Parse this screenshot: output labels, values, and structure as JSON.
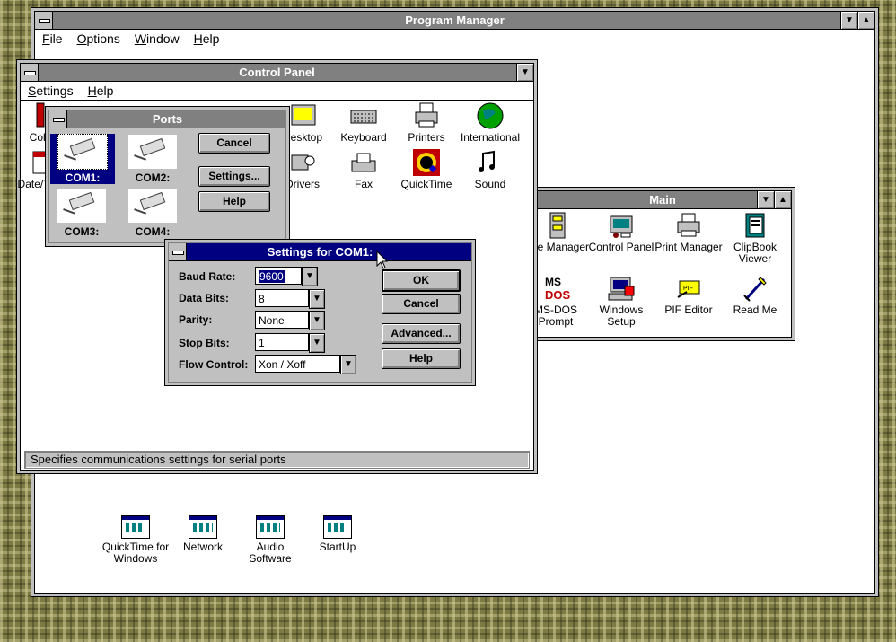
{
  "program_manager": {
    "title": "Program Manager",
    "menu": [
      "File",
      "Options",
      "Window",
      "Help"
    ]
  },
  "control_panel": {
    "title": "Control Panel",
    "menu": [
      "Settings",
      "Help"
    ],
    "icons": [
      {
        "label": "Color",
        "icon": "color-icon"
      },
      {
        "label": "Desktop",
        "icon": "desktop-icon"
      },
      {
        "label": "Keyboard",
        "icon": "keyboard-icon"
      },
      {
        "label": "Printers",
        "icon": "printer-icon"
      },
      {
        "label": "International",
        "icon": "globe-icon"
      },
      {
        "label": "Date/Time",
        "icon": "clock-icon"
      },
      {
        "label": "Drivers",
        "icon": "drivers-icon"
      },
      {
        "label": "Fax",
        "icon": "fax-icon"
      },
      {
        "label": "QuickTime",
        "icon": "quicktime-icon"
      },
      {
        "label": "Sound",
        "icon": "sound-icon"
      }
    ],
    "status": "Specifies communications settings for serial ports"
  },
  "ports": {
    "title": "Ports",
    "items": [
      "COM1:",
      "COM2:",
      "COM3:",
      "COM4:"
    ],
    "buttons": {
      "cancel": "Cancel",
      "settings": "Settings...",
      "help": "Help"
    }
  },
  "settings_dialog": {
    "title": "Settings for COM1:",
    "fields": {
      "baud_label": "Baud Rate:",
      "baud_value": "9600",
      "data_label": "Data Bits:",
      "data_value": "8",
      "parity_label": "Parity:",
      "parity_value": "None",
      "stop_label": "Stop Bits:",
      "stop_value": "1",
      "flow_label": "Flow Control:",
      "flow_value": "Xon / Xoff"
    },
    "buttons": {
      "ok": "OK",
      "cancel": "Cancel",
      "advanced": "Advanced...",
      "help": "Help"
    }
  },
  "main_group": {
    "title": "Main",
    "icons": [
      {
        "label": "File Manager",
        "icon": "file-manager-icon"
      },
      {
        "label": "Control Panel",
        "icon": "control-panel-icon"
      },
      {
        "label": "Print Manager",
        "icon": "print-manager-icon"
      },
      {
        "label": "ClipBook Viewer",
        "icon": "clipbook-icon"
      },
      {
        "label": "MS-DOS Prompt",
        "icon": "msdos-icon"
      },
      {
        "label": "Windows Setup",
        "icon": "windows-setup-icon"
      },
      {
        "label": "PIF Editor",
        "icon": "pif-editor-icon"
      },
      {
        "label": "Read Me",
        "icon": "read-me-icon"
      }
    ]
  },
  "groups": [
    "QuickTime for Windows",
    "Network",
    "Audio Software",
    "StartUp"
  ],
  "colors": {
    "active_title": "#000080",
    "inactive_title": "#808080",
    "dialog_bg": "#c0c0c0"
  }
}
